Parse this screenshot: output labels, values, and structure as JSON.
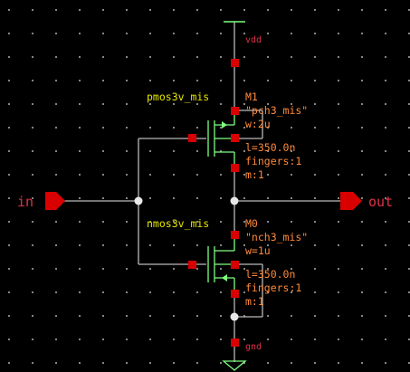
{
  "colors": {
    "wire": "#b9b9b9",
    "pin": "#d80000",
    "net_label": "#e0304a",
    "prop_text": "#ff8a3a",
    "cell_name": "#e6e600",
    "symbol": "#7fff7f"
  },
  "nets": {
    "vdd": "vdd",
    "gnd": "gnd",
    "in": "in",
    "out": "out"
  },
  "pmos": {
    "cell": "pmos3v_mis",
    "inst": "M1",
    "model": "\"pch3_mis\"",
    "w": "w:2u",
    "l": "l=350.0n",
    "fingers": "fingers:1",
    "m": "m:1"
  },
  "nmos": {
    "cell": "nmos3v_mis",
    "inst": "M0",
    "model": "\"nch3_mis\"",
    "w": "w=1u",
    "l": "l=350.0n",
    "fingers": "fingers:1",
    "m": "m:1"
  }
}
